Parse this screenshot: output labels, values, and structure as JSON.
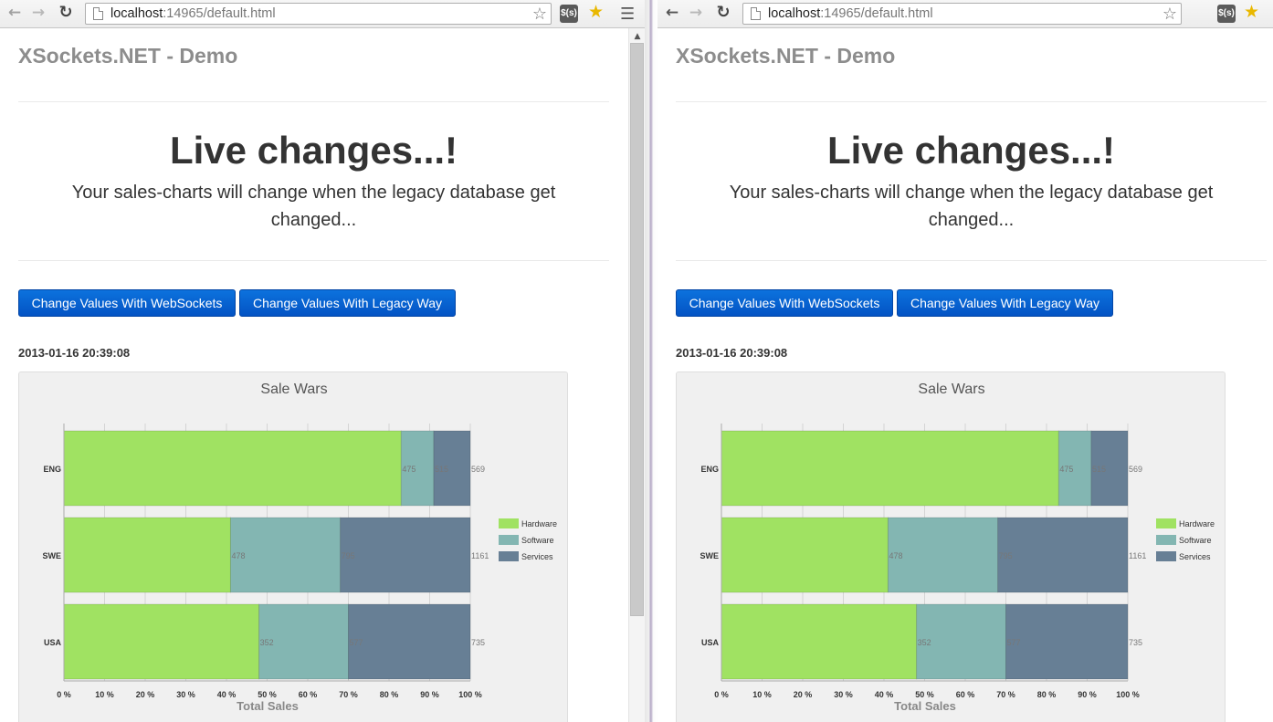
{
  "windows": [
    {
      "url_host": "localhost",
      "url_rest": ":14965/default.html",
      "ext_label": "$(s)",
      "brand": "XSockets.NET - Demo",
      "hero_title": "Live changes...!",
      "hero_subtitle": "Your sales-charts will change when the legacy database get changed...",
      "btn_websockets": "Change Values With WebSockets",
      "btn_legacy": "Change Values With Legacy Way",
      "timestamp": "2013-01-16 20:39:08"
    },
    {
      "url_host": "localhost",
      "url_rest": ":14965/default.html",
      "ext_label": "$(s)",
      "brand": "XSockets.NET - Demo",
      "hero_title": "Live changes...!",
      "hero_subtitle": "Your sales-charts will change when the legacy database get changed...",
      "btn_websockets": "Change Values With WebSockets",
      "btn_legacy": "Change Values With Legacy Way",
      "timestamp": "2013-01-16 20:39:08"
    }
  ],
  "icons": {
    "back": "arrow-left-icon",
    "forward": "arrow-right-icon",
    "reload": "reload-icon",
    "page": "page-icon",
    "bookmark": "star-outline-icon",
    "extension": "extension-icon",
    "bookmark_manager": "star-gold-icon",
    "menu": "menu-icon",
    "scroll_up": "chevron-up-icon"
  },
  "colors": {
    "hardware": "#a0e262",
    "software": "#83b6b2",
    "services": "#677f95",
    "button": "#0a63d4"
  },
  "chart_data": [
    {
      "type": "bar",
      "orientation": "horizontal",
      "stacked": "percent",
      "title": "Sale Wars",
      "xlabel": "Total Sales",
      "ylabel": "",
      "categories": [
        "ENG",
        "SWE",
        "USA"
      ],
      "xlim": [
        0,
        100
      ],
      "xticks": [
        "0 %",
        "10 %",
        "20 %",
        "30 %",
        "40 %",
        "50 %",
        "60 %",
        "70 %",
        "80 %",
        "90 %",
        "100 %"
      ],
      "series": [
        {
          "name": "Hardware",
          "values": [
            83,
            41,
            48
          ],
          "color": "#a0e262",
          "labels": [
            "",
            "",
            ""
          ]
        },
        {
          "name": "Software",
          "values": [
            8,
            27,
            22
          ],
          "color": "#83b6b2",
          "labels": [
            "475",
            "478",
            "352"
          ]
        },
        {
          "name": "Services",
          "values": [
            9,
            32,
            30
          ],
          "color": "#677f95",
          "labels": [
            "515",
            "795",
            "577"
          ]
        }
      ],
      "totals": [
        "569",
        "1161",
        "735"
      ],
      "legend": "right",
      "grid": true
    },
    {
      "type": "bar",
      "orientation": "horizontal",
      "stacked": "percent",
      "title": "Sale Wars",
      "xlabel": "Total Sales",
      "ylabel": "",
      "categories": [
        "ENG",
        "SWE",
        "USA"
      ],
      "xlim": [
        0,
        100
      ],
      "xticks": [
        "0 %",
        "10 %",
        "20 %",
        "30 %",
        "40 %",
        "50 %",
        "60 %",
        "70 %",
        "80 %",
        "90 %",
        "100 %"
      ],
      "series": [
        {
          "name": "Hardware",
          "values": [
            83,
            41,
            48
          ],
          "color": "#a0e262",
          "labels": [
            "",
            "",
            ""
          ]
        },
        {
          "name": "Software",
          "values": [
            8,
            27,
            22
          ],
          "color": "#83b6b2",
          "labels": [
            "475",
            "478",
            "352"
          ]
        },
        {
          "name": "Services",
          "values": [
            9,
            32,
            30
          ],
          "color": "#677f95",
          "labels": [
            "515",
            "795",
            "577"
          ]
        }
      ],
      "totals": [
        "569",
        "1161",
        "735"
      ],
      "legend": "right",
      "grid": true
    }
  ]
}
